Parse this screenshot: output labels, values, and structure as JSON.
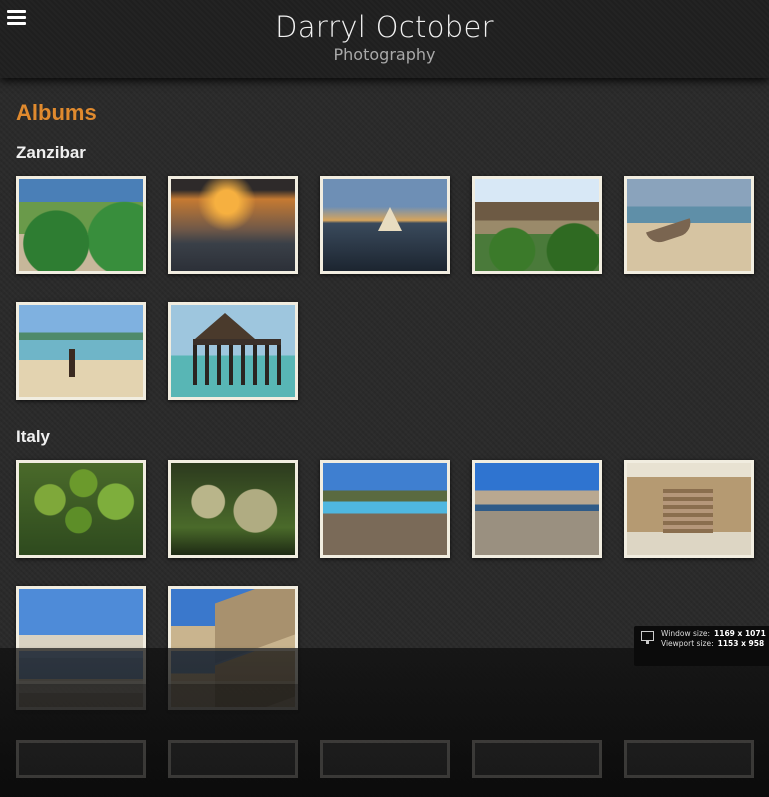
{
  "header": {
    "title": "Darryl October",
    "subtitle": "Photography"
  },
  "main": {
    "heading": "Albums",
    "albums": [
      {
        "title": "Zanzibar",
        "photos": [
          "garden-path",
          "sunset-clouds",
          "dhow-sunset",
          "thatched-lodge",
          "beached-boat",
          "beach-walker",
          "stilt-hut"
        ]
      },
      {
        "title": "Italy",
        "photos": [
          "green-fruit",
          "fuzzy-fruit",
          "swimming-pool",
          "rocky-coast",
          "baroque-facade",
          "town-lamppost",
          "church-facade"
        ]
      }
    ]
  },
  "size_panel": {
    "window_label": "Window size:",
    "window_value": "1169 x 1071",
    "viewport_label": "Viewport size:",
    "viewport_value": "1153 x 958"
  },
  "icons": {
    "menu": "hamburger-menu-icon",
    "monitor": "monitor-icon"
  },
  "colors": {
    "accent": "#e08a2e",
    "background": "#2a2a2a",
    "header_bg": "#1f1f1f",
    "frame": "#f1ede0"
  }
}
